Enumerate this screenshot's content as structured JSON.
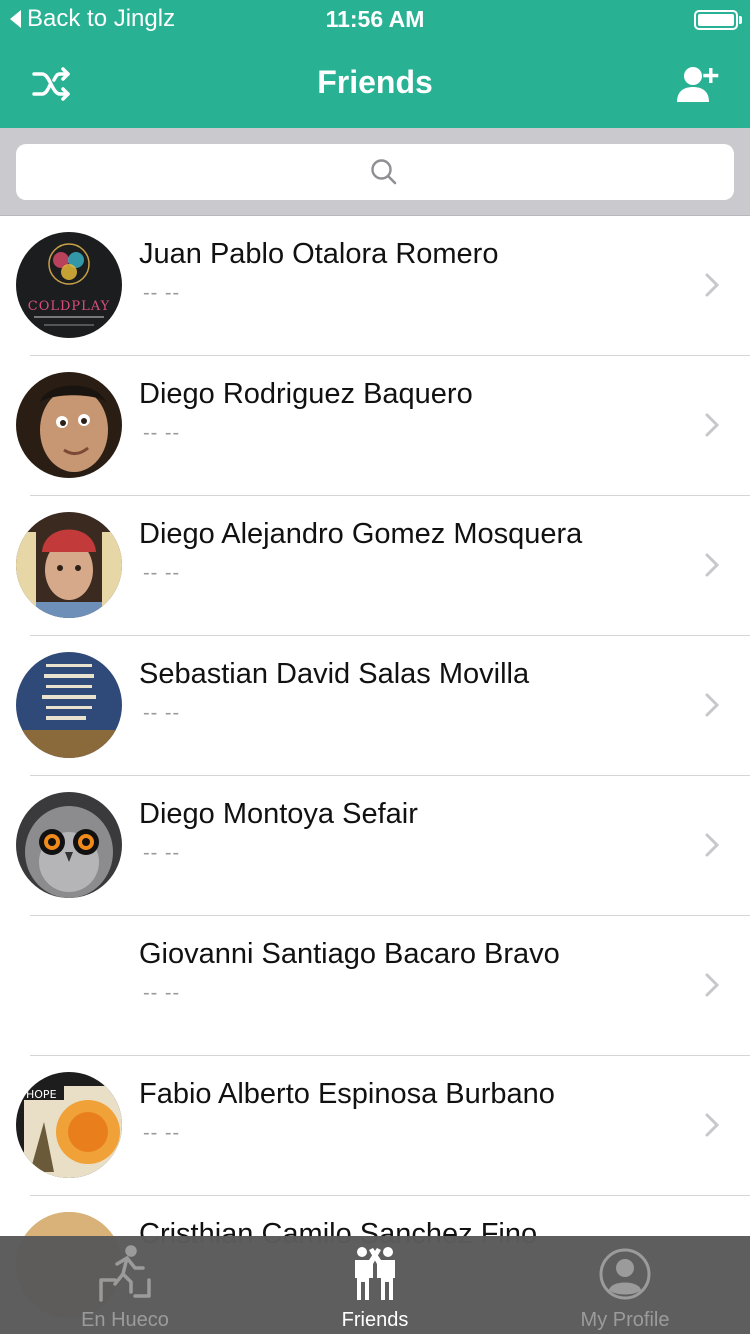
{
  "status": {
    "back_label": "Back to Jinglz",
    "time": "11:56 AM"
  },
  "nav": {
    "title": "Friends",
    "left_icon": "shuffle-icon",
    "right_icon": "add-user-icon"
  },
  "search": {
    "placeholder": ""
  },
  "friends": [
    {
      "name": "Juan Pablo Otalora Romero",
      "subtitle": "-- --",
      "avatar": "coldplay-album-art"
    },
    {
      "name": "Diego Rodriguez Baquero",
      "subtitle": "-- --",
      "avatar": "face-photo"
    },
    {
      "name": "Diego Alejandro Gomez Mosquera",
      "subtitle": "-- --",
      "avatar": "face-photo-red-beanie"
    },
    {
      "name": "Sebastian David Salas Movilla",
      "subtitle": "-- --",
      "avatar": "quote-poster"
    },
    {
      "name": "Diego Montoya Sefair",
      "subtitle": "-- --",
      "avatar": "owl-photo"
    },
    {
      "name": "Giovanni Santiago Bacaro Bravo",
      "subtitle": "-- --",
      "avatar": "none"
    },
    {
      "name": "Fabio Alberto Espinosa Burbano",
      "subtitle": "-- --",
      "avatar": "hope-poster"
    },
    {
      "name": "Cristhian Camilo Sanchez Fino",
      "subtitle": "",
      "avatar": "sunset-photo"
    }
  ],
  "tabs": [
    {
      "label": "En Hueco",
      "icon": "running-person-icon",
      "active": false
    },
    {
      "label": "Friends",
      "icon": "friends-icon",
      "active": true
    },
    {
      "label": "My Profile",
      "icon": "profile-icon",
      "active": false
    }
  ],
  "colors": {
    "accent": "#29b193",
    "tabbar": "#5b5b5b",
    "tab_active": "#ffffff",
    "tab_inactive": "#9a9a9a"
  }
}
